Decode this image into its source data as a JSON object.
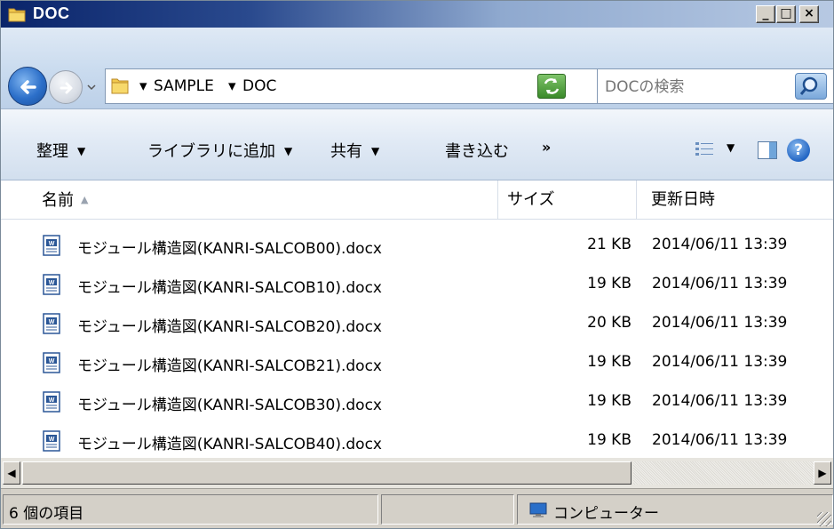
{
  "window": {
    "title": "DOC",
    "minimize_label": "_",
    "maximize_label": "□",
    "close_label": "×"
  },
  "address": {
    "path": [
      "SAMPLE",
      "DOC"
    ],
    "separator": "▾",
    "dropdown": "▾"
  },
  "search": {
    "placeholder": "DOCの検索"
  },
  "commands": {
    "organize": "整理",
    "add_to_library": "ライブラリに追加",
    "share": "共有",
    "burn": "書き込む",
    "more": "»",
    "caret": "▼"
  },
  "columns": {
    "name": "名前",
    "size": "サイズ",
    "date": "更新日時",
    "sort_indicator": "▲"
  },
  "files": [
    {
      "name": "モジュール構造図(KANRI-SALCOB00).docx",
      "size": "21 KB",
      "date": "2014/06/11 13:39"
    },
    {
      "name": "モジュール構造図(KANRI-SALCOB10).docx",
      "size": "19 KB",
      "date": "2014/06/11 13:39"
    },
    {
      "name": "モジュール構造図(KANRI-SALCOB20).docx",
      "size": "20 KB",
      "date": "2014/06/11 13:39"
    },
    {
      "name": "モジュール構造図(KANRI-SALCOB21).docx",
      "size": "19 KB",
      "date": "2014/06/11 13:39"
    },
    {
      "name": "モジュール構造図(KANRI-SALCOB30).docx",
      "size": "19 KB",
      "date": "2014/06/11 13:39"
    },
    {
      "name": "モジュール構造図(KANRI-SALCOB40).docx",
      "size": "19 KB",
      "date": "2014/06/11 13:39"
    }
  ],
  "scrollbar": {
    "left_arrow": "◀",
    "right_arrow": "▶"
  },
  "status": {
    "item_count": "6 個の項目",
    "zone": "コンピューター"
  },
  "icons": {
    "folder": "folder-icon",
    "word_doc": "word-document-icon",
    "back": "back-arrow-icon",
    "forward": "forward-arrow-icon",
    "refresh": "refresh-icon",
    "search": "search-icon",
    "view": "view-options-icon",
    "preview_pane": "preview-pane-icon",
    "help": "help-icon",
    "computer": "computer-icon"
  },
  "colors": {
    "title_bar_start": "#0a246a",
    "title_bar_end": "#b7c9e3",
    "address_bg": "#cbdcef",
    "command_bg": "#e1eaf5"
  }
}
